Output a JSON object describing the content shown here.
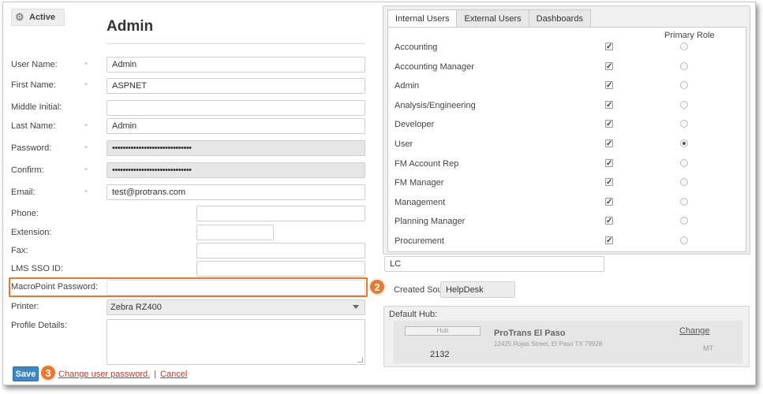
{
  "status": {
    "label": "Active"
  },
  "page_title": "Admin",
  "form": {
    "user_name": {
      "label": "User Name:",
      "value": "Admin"
    },
    "first_name": {
      "label": "First Name:",
      "value": "ASPNET"
    },
    "middle_initial": {
      "label": "Middle Initial:",
      "value": ""
    },
    "last_name": {
      "label": "Last Name:",
      "value": "Admin"
    },
    "password": {
      "label": "Password:",
      "value": "••••••••••••••••••••••••••••••"
    },
    "confirm": {
      "label": "Confirm:",
      "value": "••••••••••••••••••••••••••••••"
    },
    "email": {
      "label": "Email:",
      "value": "test@protrans.com"
    },
    "phone": {
      "label": "Phone:",
      "value": ""
    },
    "extension": {
      "label": "Extension:",
      "value": ""
    },
    "fax": {
      "label": "Fax:",
      "value": ""
    },
    "lms_sso_id": {
      "label": "LMS SSO ID:",
      "value": ""
    },
    "macropoint_password": {
      "label": "MacroPoint Password:",
      "value": ""
    },
    "printer": {
      "label": "Printer:",
      "value": "Zebra RZ400"
    },
    "profile_details": {
      "label": "Profile Details:"
    },
    "required_mark": "*"
  },
  "callouts": {
    "two": "2",
    "three": "3"
  },
  "actions": {
    "save_label": "Save",
    "change_password": "Change user password.",
    "separator": "|",
    "cancel": "Cancel"
  },
  "tabs": [
    {
      "label": "Internal Users",
      "active": true
    },
    {
      "label": "External Users",
      "active": false
    },
    {
      "label": "Dashboards",
      "active": false
    }
  ],
  "roles_header": "Primary Role",
  "roles": [
    {
      "name": "Accounting",
      "checked": true,
      "primary": false
    },
    {
      "name": "Accounting Manager",
      "checked": true,
      "primary": false
    },
    {
      "name": "Admin",
      "checked": true,
      "primary": false
    },
    {
      "name": "Analysis/Engineering",
      "checked": true,
      "primary": false
    },
    {
      "name": "Developer",
      "checked": true,
      "primary": false
    },
    {
      "name": "User",
      "checked": true,
      "primary": true
    },
    {
      "name": "FM Account Rep",
      "checked": true,
      "primary": false
    },
    {
      "name": "FM Manager",
      "checked": true,
      "primary": false
    },
    {
      "name": "Management",
      "checked": true,
      "primary": false
    },
    {
      "name": "Planning Manager",
      "checked": true,
      "primary": false
    },
    {
      "name": "Procurement",
      "checked": true,
      "primary": false
    }
  ],
  "lc_field": {
    "value": "LC"
  },
  "created_source": {
    "label": "Created Source:",
    "value": "HelpDesk"
  },
  "default_hub": {
    "title": "Default Hub:",
    "tag": "Hub",
    "number": "2132",
    "name": "ProTrans El Paso",
    "address": "12425 Rojas Street, El Paso TX 79928",
    "change_label": "Change",
    "state": "MT"
  }
}
